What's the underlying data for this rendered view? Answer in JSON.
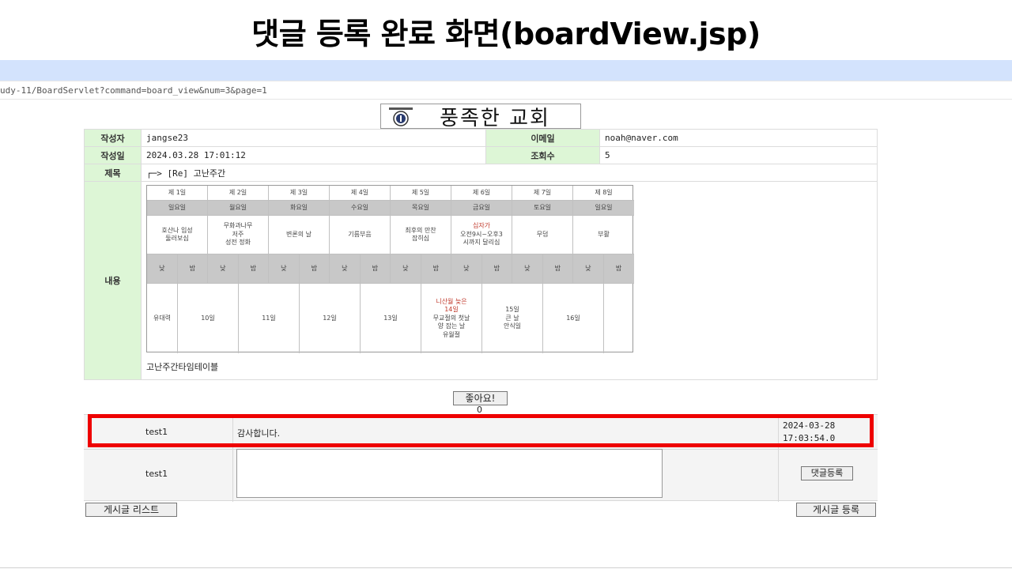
{
  "slide_title": "댓글 등록 완료 화면(boardView.jsp)",
  "url": "udy-11/BoardServlet?command=board_view&num=3&page=1",
  "logo": {
    "name": "풍족한 교회",
    "icon": "church-seal-icon"
  },
  "post": {
    "writer_label": "작성자",
    "writer": "jangse23",
    "email_label": "이메일",
    "email": "noah@naver.com",
    "date_label": "작성일",
    "date": "2024.03.28 17:01:12",
    "views_label": "조회수",
    "views": "5",
    "subject_label": "제목",
    "subject": "┌─> [Re] 고난주간",
    "content_label": "내용",
    "content_caption": "고난주간타임테이블"
  },
  "week_table": {
    "days": [
      "제 1일",
      "제 2일",
      "제 3일",
      "제 4일",
      "제 5일",
      "제 6일",
      "제 7일",
      "제 8일"
    ],
    "weekdays": [
      "일요일",
      "월요일",
      "화요일",
      "수요일",
      "목요일",
      "금요일",
      "토요일",
      "일요일"
    ],
    "events": [
      "호산나 입성\n둘러보심",
      "무화과나무\n저주\n성전 정화",
      "변론의 날",
      "기름부음",
      "최후의 만찬\n잡히심",
      "십자가\n오전9시~오후3\n시까지 달리심",
      "무덤",
      "부활"
    ],
    "event6_highlight": "십자가",
    "day_night": [
      "낮",
      "밤"
    ],
    "dates": [
      "유대력",
      "10일",
      "11일",
      "12일",
      "13일",
      "니산월 늦은\n14일\n무교절의 첫날\n양 잡는 날\n유월절",
      "15일\n큰 날\n안식일",
      "16일",
      ""
    ]
  },
  "like": {
    "button": "좋아요!",
    "count": "0"
  },
  "comments": [
    {
      "writer": "test1",
      "text": "감사합니다.",
      "date": "2024-03-28\n17:03:54.0"
    }
  ],
  "comment_form": {
    "writer": "test1",
    "submit": "댓글등록",
    "placeholder": ""
  },
  "buttons": {
    "list": "게시글 리스트",
    "write": "게시글 등록"
  },
  "colors": {
    "label_bg": "#ddf6d6",
    "highlight": "#ee0000",
    "browser_bar": "#d3e3fd"
  }
}
